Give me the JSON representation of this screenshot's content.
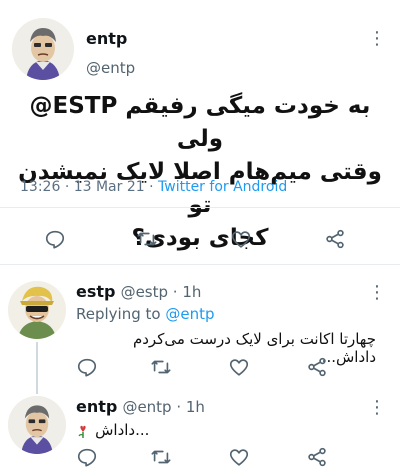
{
  "main_tweet": {
    "display_name": "entp",
    "handle": "@entp",
    "text_line1": "به خودت میگی رفیقم ESTP@ ولی",
    "text_line2": "وقتی میم‌هام اصلا لایک نمیشدن تو",
    "text_line3": "کجای بودی؟",
    "time": "13:26",
    "date": "· 13 Mar 21 ·",
    "source": "Twitter for Android"
  },
  "reply1": {
    "display_name": "estp",
    "handle": "@estp · 1h",
    "replying_prefix": "Replying to",
    "replying_to": "@entp",
    "text": "چهارتا اکانت برای لایک درست می‌کردم داداش..."
  },
  "reply2": {
    "display_name": "entp",
    "handle": "@entp · 1h",
    "text": "داداش..."
  },
  "icons": {
    "reply": "reply-icon",
    "retweet": "retweet-icon",
    "like": "heart-icon",
    "share": "share-icon",
    "more": "more-icon"
  },
  "colors": {
    "link": "#1d9bf0",
    "muted": "#536471",
    "divider": "#e6ecf0"
  }
}
